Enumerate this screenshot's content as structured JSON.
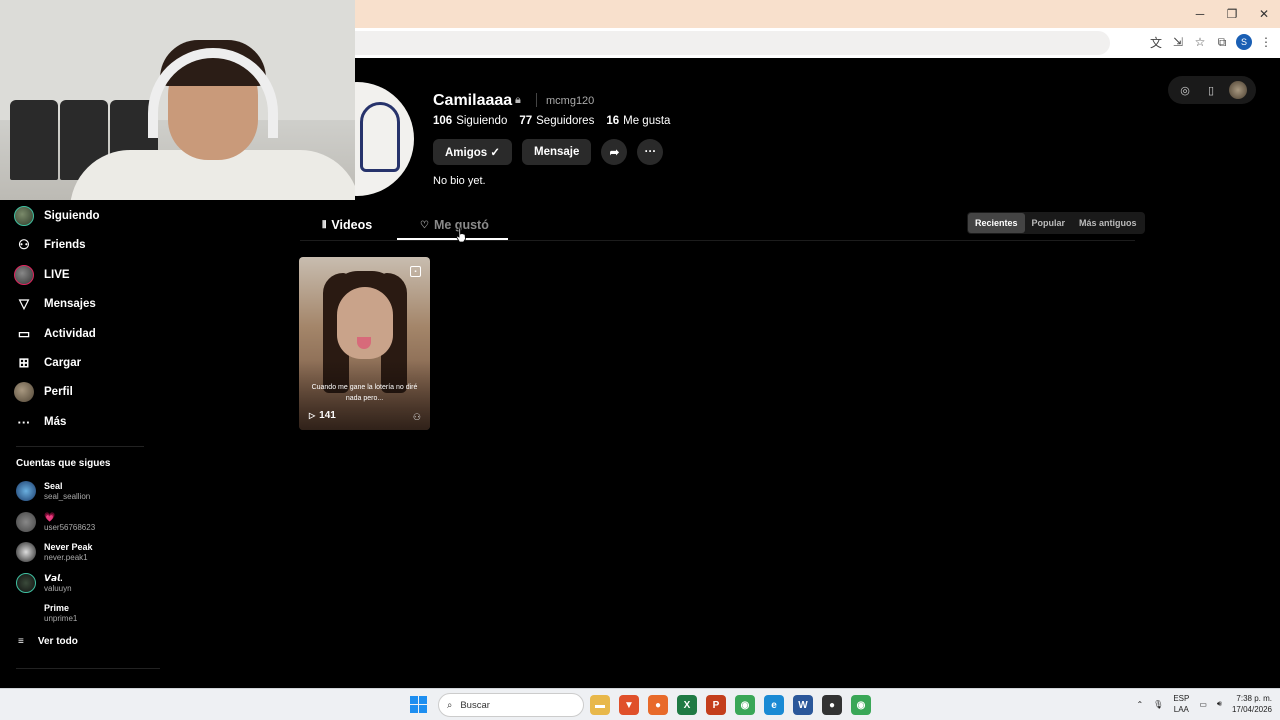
{
  "profile": {
    "name": "Camilaaaa",
    "username": "mcmg120",
    "stats": [
      {
        "value": "106",
        "label": "Siguiendo"
      },
      {
        "value": "77",
        "label": "Seguidores"
      },
      {
        "value": "16",
        "label": "Me gusta"
      }
    ],
    "buttons": {
      "friends": "Amigos ✓",
      "message": "Mensaje"
    },
    "bio": "No bio yet."
  },
  "sidebar": {
    "items": [
      {
        "label": "Siguiendo",
        "icon": "following-avatar-icon"
      },
      {
        "label": "Friends",
        "icon": "friends-icon"
      },
      {
        "label": "LIVE",
        "icon": "live-icon"
      },
      {
        "label": "Mensajes",
        "icon": "messages-icon"
      },
      {
        "label": "Actividad",
        "icon": "activity-icon"
      },
      {
        "label": "Cargar",
        "icon": "upload-icon"
      },
      {
        "label": "Perfil",
        "icon": "profile-icon"
      },
      {
        "label": "Más",
        "icon": "more-icon"
      }
    ],
    "following_title": "Cuentas que sigues",
    "accounts": [
      {
        "name": "Seal",
        "user": "seal_seallion"
      },
      {
        "name": "💗",
        "user": "user56768623"
      },
      {
        "name": "Never Peak",
        "user": "never.peak1"
      },
      {
        "name": "𝙑𝙖𝙡.",
        "user": "valuuyn"
      },
      {
        "name": "Prime",
        "user": "unprime1"
      }
    ],
    "see_all": "Ver todo"
  },
  "tabs": {
    "videos": "Videos",
    "liked": "Me gustó"
  },
  "sort": {
    "recent": "Recientes",
    "popular": "Popular",
    "oldest": "Más antiguos"
  },
  "videos": [
    {
      "caption": "Cuando me gane la lotería no diré nada pero...",
      "plays": "141"
    }
  ],
  "taskbar": {
    "search_placeholder": "Buscar",
    "lang_top": "ESP",
    "lang_bottom": "LAA",
    "time": "7:38 p. m.",
    "date": "17/04/2026"
  },
  "colors": {
    "accent": "#fe2c55",
    "background": "#000000"
  }
}
